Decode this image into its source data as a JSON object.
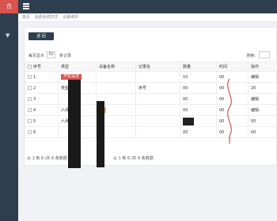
{
  "sidebar": {
    "logo": "合",
    "toggle_icon": "chevron-down-icon"
  },
  "breadcrumb": {
    "home": "首页",
    "parent": "消费系统日志",
    "current": "设备维护"
  },
  "toolbar": {
    "back_label": "返 回",
    "page_prefix": "每页显示",
    "page_value": "50",
    "page_suffix": "条记录",
    "search_label": "搜索:"
  },
  "table": {
    "headers": [
      "序号",
      "类型",
      "设备名称",
      "记录名",
      "数量",
      "时间",
      "操作"
    ],
    "rows": [
      [
        "1",
        "开机请求",
        "",
        "",
        "10",
        "00",
        "编辑"
      ],
      [
        "2",
        "类型",
        "",
        "序号",
        "00",
        "00",
        "20"
      ],
      [
        "3",
        "",
        "",
        "",
        "00",
        "00",
        "编辑"
      ],
      [
        "4",
        "六月 8 天",
        "生",
        "",
        "00",
        "00",
        "编辑"
      ],
      [
        "5",
        "六月 6 天",
        "",
        "",
        "00",
        "00",
        "00"
      ],
      [
        "6",
        "",
        "",
        "",
        "00",
        "00",
        "00"
      ]
    ]
  },
  "footer": {
    "left": "从 1 到 6 /共 6 条数据",
    "middle": "从 1 到 6 /共 6 条数据"
  }
}
